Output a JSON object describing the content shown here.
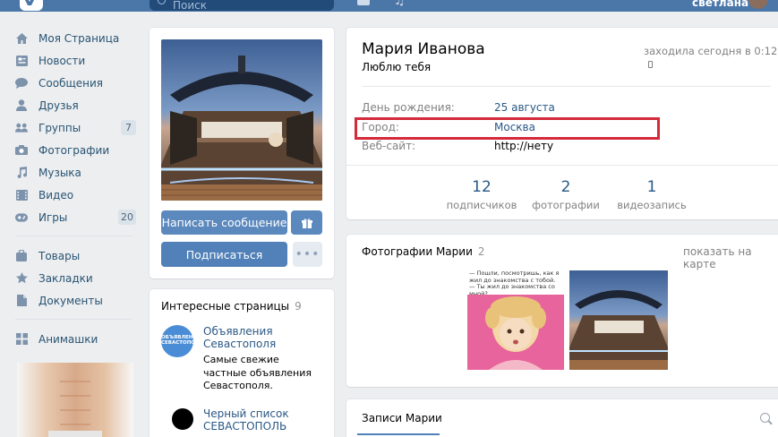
{
  "header": {
    "search_placeholder": "Поиск",
    "user_name": "светлана"
  },
  "sidebar": {
    "items": [
      {
        "label": "Моя Страница",
        "icon": "home-icon"
      },
      {
        "label": "Новости",
        "icon": "news-icon"
      },
      {
        "label": "Сообщения",
        "icon": "messages-icon"
      },
      {
        "label": "Друзья",
        "icon": "friends-icon"
      },
      {
        "label": "Группы",
        "icon": "groups-icon",
        "badge": "7"
      },
      {
        "label": "Фотографии",
        "icon": "camera-icon"
      },
      {
        "label": "Музыка",
        "icon": "music-icon"
      },
      {
        "label": "Видео",
        "icon": "video-icon"
      },
      {
        "label": "Игры",
        "icon": "gamepad-icon",
        "badge": "20"
      }
    ],
    "items2": [
      {
        "label": "Товары",
        "icon": "bag-icon"
      },
      {
        "label": "Закладки",
        "icon": "star-icon"
      },
      {
        "label": "Документы",
        "icon": "document-icon"
      }
    ],
    "items3": [
      {
        "label": "Анимашки",
        "icon": "apps-icon"
      }
    ]
  },
  "profile": {
    "send_message": "Написать сообщение",
    "subscribe": "Подписаться",
    "name": "Мария Иванова",
    "status": "Люблю тебя",
    "online": "заходила сегодня в 0:12",
    "birthday_label": "День рождения:",
    "birthday_value": "25 августа",
    "city_label": "Город:",
    "city_value": "Москва",
    "site_label": "Веб-сайт:",
    "site_value": "http://нету",
    "counters": [
      {
        "num": "12",
        "label": "подписчиков"
      },
      {
        "num": "2",
        "label": "фотографии"
      },
      {
        "num": "1",
        "label": "видеозапись"
      }
    ]
  },
  "interesting": {
    "title": "Интересные страницы",
    "count": "9",
    "pages": [
      {
        "name": "Объявления Севастополя",
        "desc": "Самые свежие частные объявления Севастополя.",
        "thumb_text": "ОБЪЯВЛЕНИЯ СЕВАСТОПОЛЯ"
      },
      {
        "name": "Черный список СЕВАСТОПОЛЬ",
        "desc": ""
      }
    ]
  },
  "photos": {
    "title": "Фотографии Марии",
    "count": "2",
    "map_link": "показать на карте",
    "photo1_caption": "— Пошли, посмотришь, как я жил до знакомства с тобой. — Ты жил до знакомства со мной?"
  },
  "wall": {
    "tab": "Записи Марии"
  },
  "colors": {
    "header": "#4a76a8",
    "accent": "#5181b8",
    "link": "#2a5885",
    "highlight_box": "#d42a3a"
  }
}
